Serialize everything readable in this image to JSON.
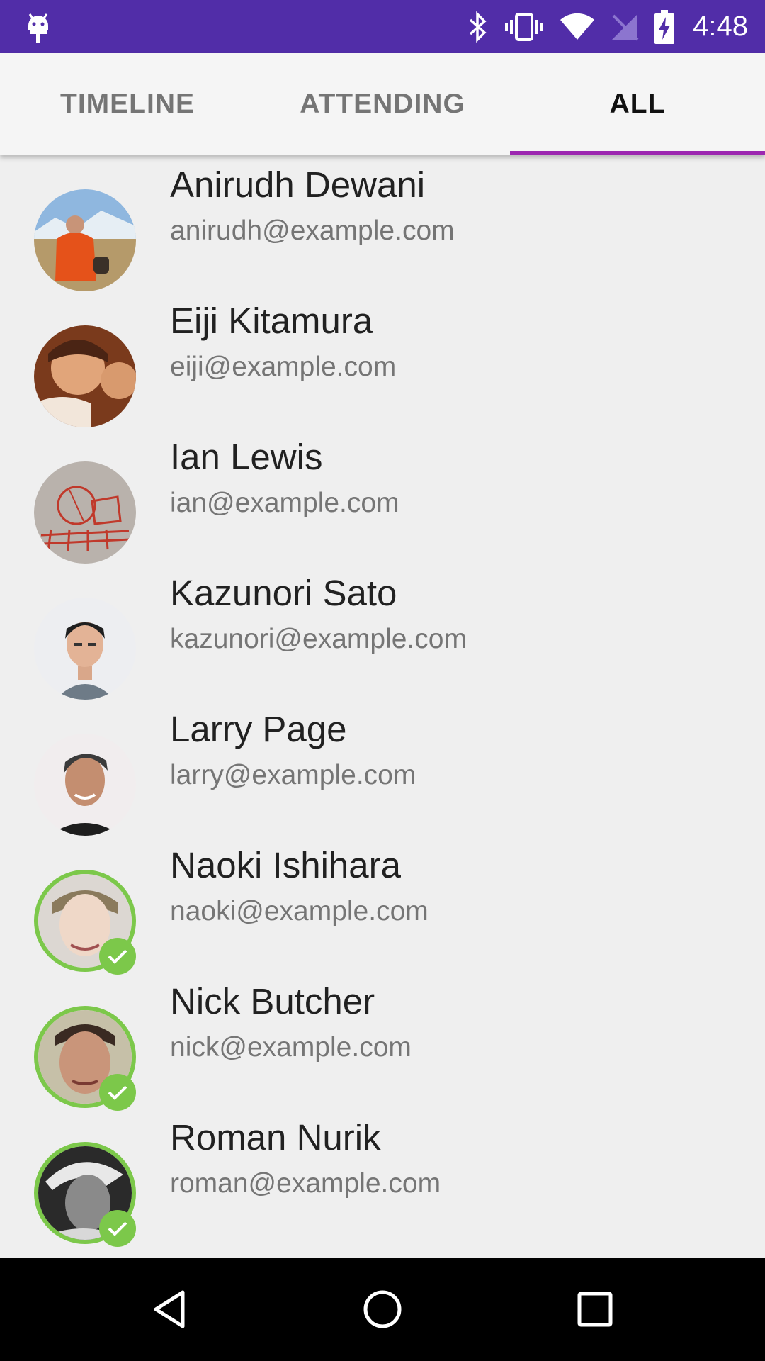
{
  "status_bar": {
    "time": "4:48",
    "icons": [
      "android-icon",
      "bluetooth-icon",
      "vibrate-icon",
      "wifi-icon",
      "no-signal-icon",
      "battery-charging-icon"
    ],
    "background_color": "#512DA8"
  },
  "tabs": [
    {
      "label": "TIMELINE",
      "selected": false
    },
    {
      "label": "ATTENDING",
      "selected": false
    },
    {
      "label": "ALL",
      "selected": true
    }
  ],
  "accent_color": "#9C27B0",
  "check_color": "#7CC84A",
  "people": [
    {
      "name": "Anirudh Dewani",
      "email": "anirudh@example.com",
      "checked_in": false
    },
    {
      "name": "Eiji Kitamura",
      "email": "eiji@example.com",
      "checked_in": false
    },
    {
      "name": "Ian Lewis",
      "email": "ian@example.com",
      "checked_in": false
    },
    {
      "name": "Kazunori Sato",
      "email": "kazunori@example.com",
      "checked_in": false
    },
    {
      "name": "Larry Page",
      "email": "larry@example.com",
      "checked_in": false
    },
    {
      "name": "Naoki Ishihara",
      "email": "naoki@example.com",
      "checked_in": true
    },
    {
      "name": "Nick Butcher",
      "email": "nick@example.com",
      "checked_in": true
    },
    {
      "name": "Roman Nurik",
      "email": "roman@example.com",
      "checked_in": true
    }
  ],
  "nav_bar": {
    "buttons": [
      "back-icon",
      "home-icon",
      "recents-icon"
    ]
  }
}
